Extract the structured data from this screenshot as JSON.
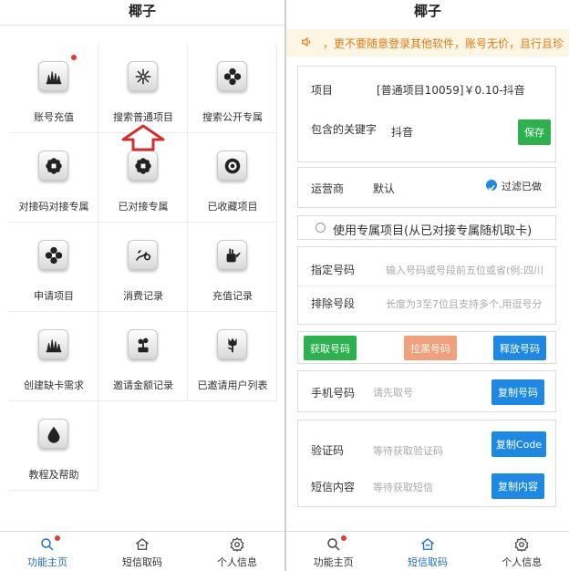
{
  "left": {
    "title": "椰子",
    "grid": [
      {
        "label": "账号充值",
        "icon": "grass-icon"
      },
      {
        "label": "搜索普通项目",
        "icon": "flower-outline-icon"
      },
      {
        "label": "搜索公开专属",
        "icon": "flower-icon"
      },
      {
        "label": "对接码对接专属",
        "icon": "flower-icon"
      },
      {
        "label": "已对接专属",
        "icon": "flower-icon"
      },
      {
        "label": "已收藏项目",
        "icon": "ring-flower-icon"
      },
      {
        "label": "申请项目",
        "icon": "flower-icon"
      },
      {
        "label": "消费记录",
        "icon": "sprout-icon"
      },
      {
        "label": "充值记录",
        "icon": "watering-can-icon"
      },
      {
        "label": "创建缺卡需求",
        "icon": "grass-icon"
      },
      {
        "label": "邀请金额记录",
        "icon": "plant-icon"
      },
      {
        "label": "已邀请用户列表",
        "icon": "tulip-icon"
      },
      {
        "label": "教程及帮助",
        "icon": "drop-icon"
      }
    ],
    "tabs": [
      {
        "label": "功能主页",
        "icon": "search-icon",
        "active": true
      },
      {
        "label": "短信取码",
        "icon": "home-icon",
        "active": false
      },
      {
        "label": "个人信息",
        "icon": "gear-icon",
        "active": false
      }
    ]
  },
  "right": {
    "title": "椰子",
    "notice": "，更不要随意登录其他软件，账号无价，且行且珍",
    "project": {
      "label": "项目",
      "value": "[普通项目10059]￥0.10-抖音",
      "keyword_label": "包含的关键字",
      "keyword_value": "抖音",
      "save": "保存"
    },
    "operator": {
      "label": "运营商",
      "value": "默认",
      "filter": "过滤已做"
    },
    "exclusive": "使用专属项目(从已对接专属随机取卡)",
    "numbers": {
      "assign_label": "指定号码",
      "assign_placeholder": "输入号码或号段前五位或省(例:四川",
      "exclude_label": "排除号段",
      "exclude_placeholder": "长度为3至7位且支持多个,用逗号分"
    },
    "actions": {
      "get": "获取号码",
      "block": "拉黑号码",
      "release": "释放号码"
    },
    "phone": {
      "label": "手机号码",
      "placeholder": "请先取号",
      "copy": "复制号码"
    },
    "code": {
      "label": "验证码",
      "placeholder": "等待获取验证码",
      "copy": "复制Code",
      "sms_label": "短信内容",
      "sms_placeholder": "等待获取短信",
      "copy_sms": "复制内容"
    },
    "tabs": [
      {
        "label": "功能主页",
        "icon": "search-icon",
        "active": false
      },
      {
        "label": "短信取码",
        "icon": "home-icon",
        "active": true
      },
      {
        "label": "个人信息",
        "icon": "gear-icon",
        "active": false
      }
    ]
  },
  "colors": {
    "accent": "#1f6fd1",
    "green": "#2bb24c",
    "orange": "#f2a07b",
    "blue": "#1e88e5",
    "notice_text": "#e07b18",
    "notice_bg": "#fdf6e3",
    "arrow": "#d32f2f"
  }
}
